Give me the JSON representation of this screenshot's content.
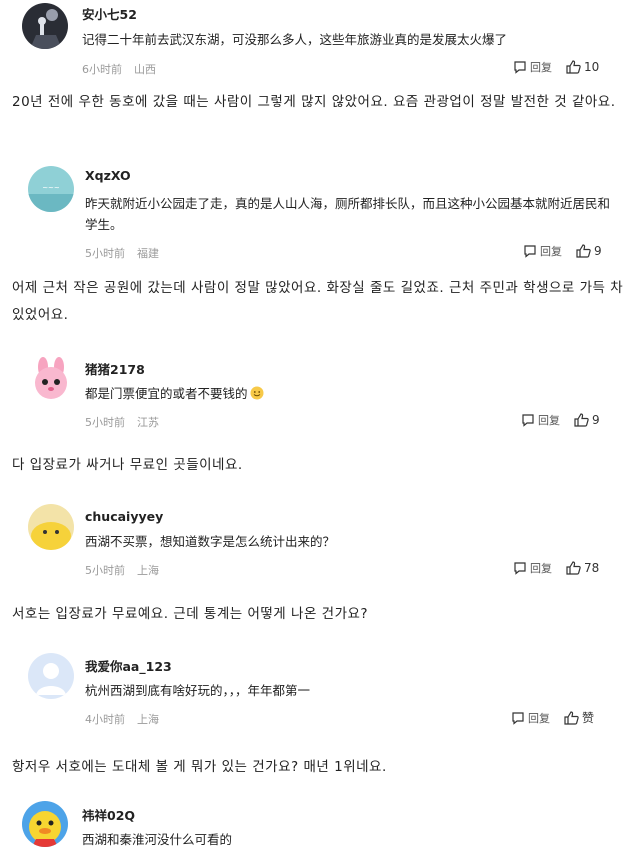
{
  "comments": [
    {
      "username": "安小七52",
      "text": "记得二十年前去武汉东湖，可没那么多人，这些年旅游业真的是发展太火爆了",
      "time": "6小时前",
      "location": "山西",
      "reply_label": "回复",
      "likes": "10",
      "translation": "20년 전에 우한 동호에 갔을 때는 사람이 그렇게 많지 않았어요. 요즘 관광업이 정말 발전한 것 같아요.",
      "avatar_icon": "night-scene-avatar"
    },
    {
      "username": "XqzXO",
      "text": "昨天就附近小公园走了走，真的是人山人海，厕所都排长队，而且这种小公园基本就附近居民和学生。",
      "time": "5小时前",
      "location": "福建",
      "reply_label": "回复",
      "likes": "9",
      "translation": "어제 근처 작은 공원에 갔는데 사람이 정말 많았어요. 화장실 줄도 길었죠. 근처 주민과 학생으로 가득 차 있었어요.",
      "avatar_icon": "teal-card-avatar"
    },
    {
      "username": "猪猪2178",
      "text": "都是门票便宜的或者不要钱的",
      "time": "5小时前",
      "location": "江苏",
      "reply_label": "回复",
      "likes": "9",
      "translation": "다 입장료가 싸거나 무료인 곳들이네요.",
      "avatar_icon": "pink-bunny-avatar"
    },
    {
      "username": "chucaiyyey",
      "text": "西湖不买票，想知道数字是怎么统计出来的？",
      "time": "5小时前",
      "location": "上海",
      "reply_label": "回复",
      "likes": "78",
      "translation": "서호는 입장료가 무료예요. 근데 통계는 어떻게 나온 건가요?",
      "avatar_icon": "yellow-chick-avatar"
    },
    {
      "username": "我爱你aa_123",
      "text": "杭州西湖到底有啥好玩的，，，年年都第一",
      "time": "4小时前",
      "location": "上海",
      "reply_label": "回复",
      "likes": "赞",
      "translation": "항저우 서호에는 도대체 볼 게 뭐가 있는 건가요? 매년 1위네요.",
      "avatar_icon": "default-user-avatar"
    },
    {
      "username": "祎祥02Q",
      "text": "西湖和秦淮河没什么可看的",
      "avatar_icon": "yellow-duck-avatar"
    }
  ],
  "colors": {
    "meta": "#9a9a9a",
    "text": "#222222",
    "background": "#ffffff"
  }
}
